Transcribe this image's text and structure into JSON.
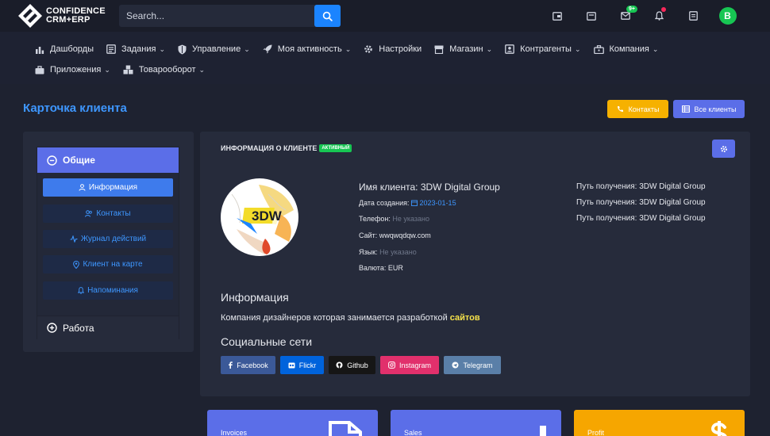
{
  "brand": {
    "line1": "CONFIDENCE",
    "line2": "CRM+ERP"
  },
  "search": {
    "placeholder": "Search..."
  },
  "topbar": {
    "messages_badge": "9+"
  },
  "avatar": {
    "letter": "B"
  },
  "menu": {
    "row1": [
      {
        "label": "Дашборды",
        "icon": "chart-icon",
        "dropdown": false
      },
      {
        "label": "Задания",
        "icon": "tasks-icon",
        "dropdown": true
      },
      {
        "label": "Управление",
        "icon": "shield-icon",
        "dropdown": true
      },
      {
        "label": "Моя активность",
        "icon": "rocket-icon",
        "dropdown": true
      },
      {
        "label": "Настройки",
        "icon": "gear-icon",
        "dropdown": false
      },
      {
        "label": "Магазин",
        "icon": "store-icon",
        "dropdown": true
      },
      {
        "label": "Контрагенты",
        "icon": "contact-card-icon",
        "dropdown": true
      },
      {
        "label": "Компания",
        "icon": "building-icon",
        "dropdown": true
      }
    ],
    "row2": [
      {
        "label": "Приложения",
        "icon": "briefcase-icon",
        "dropdown": true
      },
      {
        "label": "Товарооборот",
        "icon": "boxes-icon",
        "dropdown": true
      }
    ]
  },
  "page": {
    "title": "Карточка клиента"
  },
  "actions": {
    "contacts": "Контакты",
    "all_clients": "Все клиенты"
  },
  "sidebar": {
    "section_general": "Общие",
    "items": [
      {
        "label": "Информация",
        "active": true
      },
      {
        "label": "Контакты",
        "active": false
      },
      {
        "label": "Журнал действий",
        "active": false
      },
      {
        "label": "Клиент на карте",
        "active": false
      },
      {
        "label": "Напоминания",
        "active": false
      }
    ],
    "section_work": "Работа"
  },
  "card": {
    "title": "ИНФОРМАЦИЯ О КЛИЕНТЕ",
    "status": "АКТИВНЫЙ",
    "logo_text": "3DW"
  },
  "client": {
    "name_label": "Имя клиента:",
    "name": "3DW Digital Group",
    "created_label": "Дата создания:",
    "created": "2023-01-15",
    "phone_label": "Телефон:",
    "phone": "Не указано",
    "site_label": "Сайт:",
    "site": "wwqwqdqw.com",
    "lang_label": "Язык:",
    "lang": "Не указано",
    "currency_label": "Валюта:",
    "currency": "EUR"
  },
  "paths": {
    "label": "Путь получения:",
    "values": [
      "3DW Digital Group",
      "3DW Digital Group",
      "3DW Digital Group"
    ]
  },
  "info": {
    "heading": "Информация",
    "text": "Компания дизайнеров которая занимается разработкой",
    "highlight": "сайтов"
  },
  "social": {
    "heading": "Социальные сети",
    "links": [
      {
        "label": "Facebook",
        "color": "#3b5998"
      },
      {
        "label": "Flickr",
        "color": "#0063dc"
      },
      {
        "label": "Github",
        "color": "#161616"
      },
      {
        "label": "Instagram",
        "color": "#e1306c"
      },
      {
        "label": "Telegram",
        "color": "#5a7fa8"
      }
    ]
  },
  "stats": [
    {
      "label": "Invoices",
      "color": "#5b6ee8"
    },
    {
      "label": "Sales",
      "color": "#5b6ee8"
    },
    {
      "label": "Profit",
      "color": "#f6a600"
    }
  ],
  "colors": {
    "accent": "#5b6ee8",
    "primary": "#3e97ff",
    "success": "#17c653",
    "warning": "#f6b100"
  }
}
